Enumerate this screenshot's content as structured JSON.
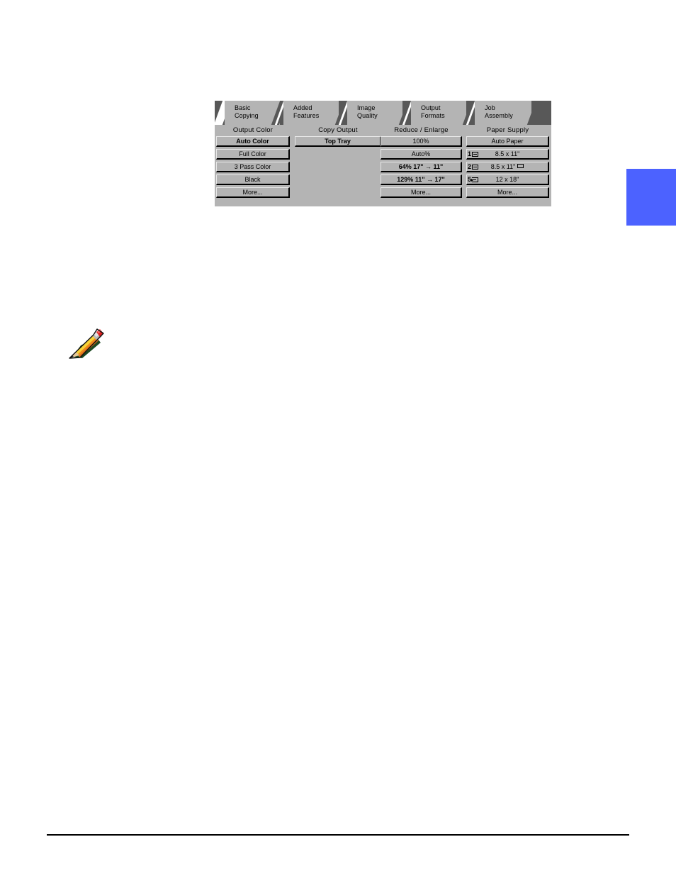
{
  "page": {
    "marker_color": "#4c62ff",
    "note_icon": "pencil-icon"
  },
  "panel": {
    "tabs": [
      {
        "line1": "Basic",
        "line2": "Copying",
        "selected": true
      },
      {
        "line1": "Added",
        "line2": "Features",
        "selected": false
      },
      {
        "line1": "Image",
        "line2": "Quality",
        "selected": false
      },
      {
        "line1": "Output",
        "line2": "Formats",
        "selected": false
      },
      {
        "line1": "Job",
        "line2": "Assembly",
        "selected": false
      }
    ],
    "columns": [
      {
        "id": "output-color",
        "heading": "Output Color",
        "buttons": [
          {
            "label": "Auto Color",
            "selected": true
          },
          {
            "label": "Full Color",
            "selected": false
          },
          {
            "label": "3 Pass Color",
            "selected": false
          },
          {
            "label": "Black",
            "selected": false
          },
          {
            "label": "More...",
            "selected": false
          }
        ]
      },
      {
        "id": "copy-output",
        "heading": "Copy Output",
        "buttons": [
          {
            "label": "Top Tray",
            "selected": true
          }
        ]
      },
      {
        "id": "reduce-enlarge",
        "heading": "Reduce / Enlarge",
        "buttons": [
          {
            "label": "100%",
            "selected": false
          },
          {
            "label": "Auto%",
            "selected": false
          },
          {
            "label": "64%  17\"  →  11\"",
            "selected": false
          },
          {
            "label": "129%  11\"  →  17\"",
            "selected": false
          },
          {
            "label": "More...",
            "selected": false
          }
        ]
      },
      {
        "id": "paper-supply",
        "heading": "Paper Supply",
        "buttons": [
          {
            "label": "Auto Paper",
            "selected": false
          },
          {
            "label": "8.5 x 11\"",
            "tray": "1",
            "icon": "paper-tray-icon",
            "selected": false
          },
          {
            "label": "8.5 x 11\"",
            "tray": "2",
            "icon": "paper-tray-icon",
            "orientation_icon": "landscape-sheet-icon",
            "selected": false
          },
          {
            "label": "12 x 18\"",
            "tray": "5",
            "icon": "bypass-paper-tray-icon",
            "selected": false
          },
          {
            "label": "More...",
            "selected": false
          }
        ]
      }
    ]
  }
}
